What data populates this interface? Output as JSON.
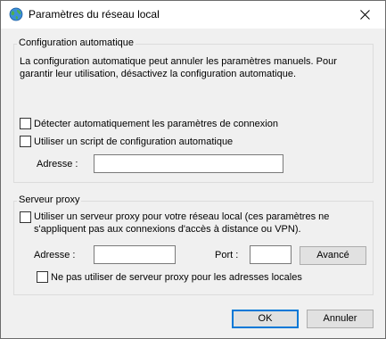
{
  "window": {
    "title": "Paramètres du réseau local"
  },
  "auto_config": {
    "group_label": "Configuration automatique",
    "description_line1": "La configuration automatique peut annuler les paramètres manuels. Pour",
    "description_line2": "garantir leur utilisation, désactivez la configuration automatique.",
    "detect_label": "Détecter automatiquement les paramètres de connexion",
    "detect_checked": false,
    "script_label": "Utiliser un script de configuration automatique",
    "script_checked": false,
    "address_label": "Adresse :",
    "address_value": ""
  },
  "proxy": {
    "group_label": "Serveur proxy",
    "use_proxy_line1": "Utiliser un serveur proxy pour votre réseau local (ces paramètres ne",
    "use_proxy_line2": "s'appliquent pas aux connexions d'accès à distance ou VPN).",
    "use_proxy_checked": false,
    "address_label": "Adresse :",
    "address_value": "",
    "port_label": "Port :",
    "port_value": "",
    "advanced_label": "Avancé",
    "bypass_label": "Ne pas utiliser de serveur proxy pour les adresses locales",
    "bypass_checked": false
  },
  "footer": {
    "ok_label": "OK",
    "cancel_label": "Annuler"
  },
  "colors": {
    "accent": "#0078d7",
    "window_bg": "#f0f0f0"
  }
}
